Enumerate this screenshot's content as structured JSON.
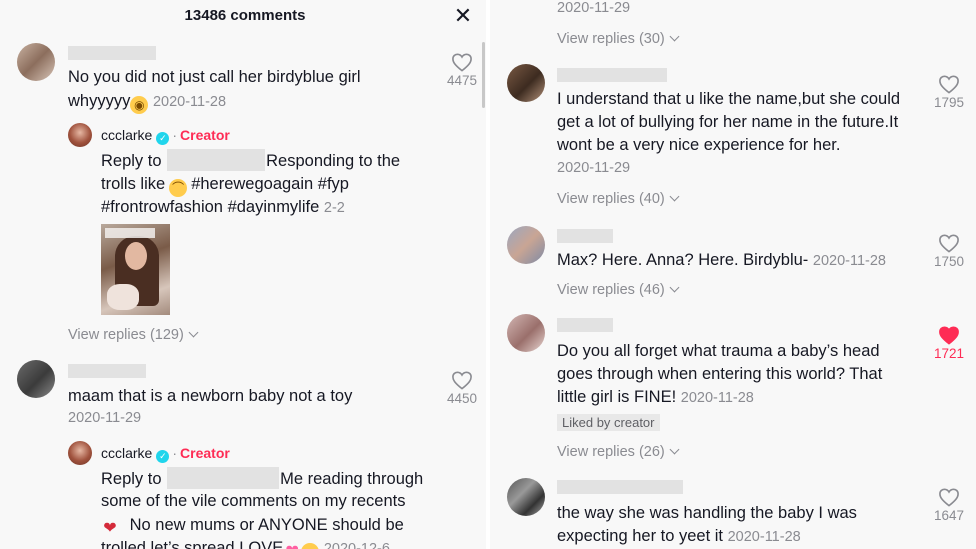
{
  "header": {
    "title": "13486 comments",
    "close_label": "✕"
  },
  "left": {
    "c1": {
      "text": "No you did not just call her birdyblue girl",
      "text2": "whyyyyy",
      "date": "2020-11-28",
      "likes": "4475"
    },
    "r1": {
      "author": "ccclarke",
      "badge": "Creator",
      "reply_prefix": "Reply to",
      "line1": "Responding to the",
      "line2a": "trolls like",
      "line2b": "#herewegoagain #fyp",
      "line3": "#frontrowfashion #dayinmylife",
      "date": "2-2"
    },
    "view_replies_1": "View replies (129)",
    "c2": {
      "text": "maam that is a newborn baby not a toy",
      "date": "2020-11-29",
      "likes": "4450"
    },
    "r2": {
      "author": "ccclarke",
      "badge": "Creator",
      "reply_prefix": "Reply to",
      "line1": "Me reading through",
      "line2": "some of the vile comments on my recents",
      "line3": "No new mums or ANYONE should be",
      "line4": "trolled let’s spread LOVE",
      "date": "2020-12-6"
    }
  },
  "right": {
    "top_date": "2020-11-29",
    "view_replies_top": "View replies (30)",
    "c1": {
      "line1": "I understand that u like the name,but she could",
      "line2": "get a lot of bullying for her name in the future.It",
      "line3": "wont be a very nice experience for her.",
      "date": "2020-11-29",
      "likes": "1795"
    },
    "view_replies_1": "View replies (40)",
    "c2": {
      "text": "Max? Here. Anna? Here. Birdyblu-",
      "date": "2020-11-28",
      "likes": "1750"
    },
    "view_replies_2": "View replies (46)",
    "c3": {
      "line1": "Do you all forget what trauma a baby’s head",
      "line2": "goes through when entering this world? That",
      "line3": "little girl is FINE!",
      "date": "2020-11-28",
      "likes": "1721",
      "liked_badge": "Liked by creator"
    },
    "view_replies_3": "View replies (26)",
    "c4": {
      "line1": "the way she was handling the baby I was",
      "line2": "expecting her to yeet it",
      "date": "2020-11-28",
      "likes": "1647"
    }
  },
  "colors": {
    "accent": "#fe2c55",
    "verified": "#20d5ec",
    "muted": "#8a8b91"
  }
}
